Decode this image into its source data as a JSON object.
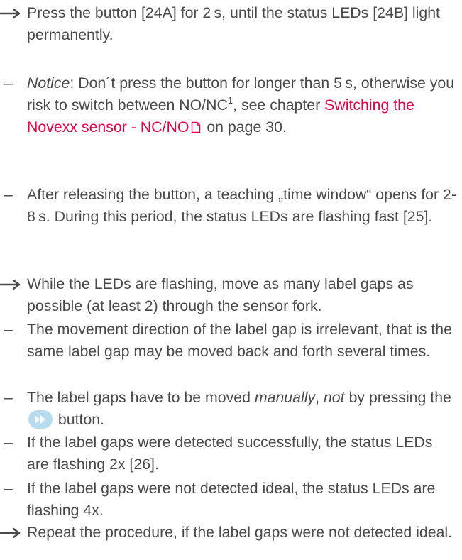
{
  "items": [
    {
      "type": "arrow",
      "text": "Press the button [24A] for 2 s, until the status LEDs [24B] light permanently."
    },
    {
      "type": "dash",
      "emph": "Notice",
      "text1": ": Don´t press the button for longer than 5 s, otherwise you risk to switch between NO/NC",
      "sup": "1",
      "text2": ", see chapter ",
      "link": "Switching the Novexx sensor - NC/NO",
      "text3": " on page 30."
    },
    {
      "type": "dash",
      "text": "After releasing the button, a teaching „time window“ opens for 2-8 s. During this period, the status LEDs are flashing fast [25]."
    },
    {
      "type": "arrow",
      "text": "While the LEDs are flashing, move as many label gaps as possible (at least 2) through the sensor fork."
    },
    {
      "type": "dash",
      "text": "The movement direction of the label gap is irrele­vant, that is the same label gap may be moved back and forth several times."
    },
    {
      "type": "dash",
      "text1": "The label gaps have to be moved ",
      "emph1": "manually",
      "text2": ", ",
      "emph2": "not",
      "text3": " by pressing the ",
      "text4": " button."
    },
    {
      "type": "dash",
      "text": "If the label gaps were detected successfully, the sta­tus LEDs are flashing 2x [26]."
    },
    {
      "type": "dash",
      "text": "If the label gaps were not detected ideal, the status LEDs are flashing 4x."
    },
    {
      "type": "arrow",
      "text": "Repeat the procedure, if the label gaps were not de­tected ideal."
    }
  ],
  "markers": {
    "dash": "–"
  },
  "colors": {
    "text": "#4a4a4a",
    "link": "#e30046",
    "ffwd_button": "#b8dcef"
  },
  "icons": [
    "arrow-right-icon",
    "document-icon",
    "fast-forward-icon"
  ]
}
